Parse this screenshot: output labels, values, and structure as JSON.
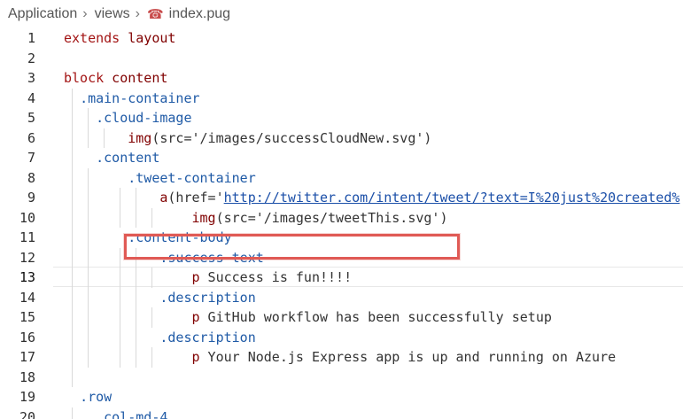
{
  "breadcrumb": {
    "items": [
      "Application",
      "views",
      "index.pug"
    ],
    "file_icon": "pug-file-icon"
  },
  "editor": {
    "current_line": 13,
    "lines": [
      {
        "num": "1",
        "segments": [
          {
            "t": "extends",
            "c": "kw"
          },
          {
            "t": " layout",
            "c": "tag"
          }
        ]
      },
      {
        "num": "2",
        "segments": []
      },
      {
        "num": "3",
        "segments": [
          {
            "t": "block",
            "c": "kw"
          },
          {
            "t": " content",
            "c": "tag"
          }
        ]
      },
      {
        "num": "4",
        "segments": [
          {
            "t": "  ",
            "c": "plain"
          },
          {
            "t": ".main-container",
            "c": "cls"
          }
        ]
      },
      {
        "num": "5",
        "segments": [
          {
            "t": "    ",
            "c": "plain"
          },
          {
            "t": ".cloud-image",
            "c": "cls"
          }
        ]
      },
      {
        "num": "6",
        "segments": [
          {
            "t": "        ",
            "c": "plain"
          },
          {
            "t": "img",
            "c": "tag"
          },
          {
            "t": "(src=",
            "c": "plain"
          },
          {
            "t": "'/images/successCloudNew.svg'",
            "c": "plain"
          },
          {
            "t": ")",
            "c": "plain"
          }
        ]
      },
      {
        "num": "7",
        "segments": [
          {
            "t": "    ",
            "c": "plain"
          },
          {
            "t": ".content",
            "c": "cls"
          }
        ]
      },
      {
        "num": "8",
        "segments": [
          {
            "t": "        ",
            "c": "plain"
          },
          {
            "t": ".tweet-container",
            "c": "cls"
          }
        ]
      },
      {
        "num": "9",
        "segments": [
          {
            "t": "            ",
            "c": "plain"
          },
          {
            "t": "a",
            "c": "tag"
          },
          {
            "t": "(href=",
            "c": "plain"
          },
          {
            "t": "'",
            "c": "plain"
          },
          {
            "t": "http://twitter.com/intent/tweet/?text=I%20just%20created%",
            "c": "link"
          }
        ]
      },
      {
        "num": "10",
        "segments": [
          {
            "t": "                ",
            "c": "plain"
          },
          {
            "t": "img",
            "c": "tag"
          },
          {
            "t": "(src=",
            "c": "plain"
          },
          {
            "t": "'/images/tweetThis.svg'",
            "c": "plain"
          },
          {
            "t": ")",
            "c": "plain"
          }
        ]
      },
      {
        "num": "11",
        "segments": [
          {
            "t": "        ",
            "c": "plain"
          },
          {
            "t": ".content-body",
            "c": "cls"
          }
        ]
      },
      {
        "num": "12",
        "segments": [
          {
            "t": "            ",
            "c": "plain"
          },
          {
            "t": ".success-text",
            "c": "cls"
          }
        ]
      },
      {
        "num": "13",
        "segments": [
          {
            "t": "                ",
            "c": "plain"
          },
          {
            "t": "p",
            "c": "tag"
          },
          {
            "t": " Success is fun!!!!",
            "c": "plain"
          }
        ]
      },
      {
        "num": "14",
        "segments": [
          {
            "t": "            ",
            "c": "plain"
          },
          {
            "t": ".description",
            "c": "cls"
          }
        ]
      },
      {
        "num": "15",
        "segments": [
          {
            "t": "                ",
            "c": "plain"
          },
          {
            "t": "p",
            "c": "tag"
          },
          {
            "t": " GitHub workflow has been successfully setup",
            "c": "plain"
          }
        ]
      },
      {
        "num": "16",
        "segments": [
          {
            "t": "            ",
            "c": "plain"
          },
          {
            "t": ".description",
            "c": "cls"
          }
        ]
      },
      {
        "num": "17",
        "segments": [
          {
            "t": "                ",
            "c": "plain"
          },
          {
            "t": "p",
            "c": "tag"
          },
          {
            "t": " Your Node.js Express app is up and running on Azure",
            "c": "plain"
          }
        ]
      },
      {
        "num": "18",
        "segments": []
      },
      {
        "num": "19",
        "segments": [
          {
            "t": "  ",
            "c": "plain"
          },
          {
            "t": ".row",
            "c": "cls"
          }
        ]
      },
      {
        "num": "20",
        "segments": [
          {
            "t": "    ",
            "c": "plain"
          },
          {
            "t": ".col-md-4",
            "c": "cls"
          }
        ]
      }
    ]
  },
  "highlight": {
    "color": "#e05a55",
    "target_line": 13
  }
}
